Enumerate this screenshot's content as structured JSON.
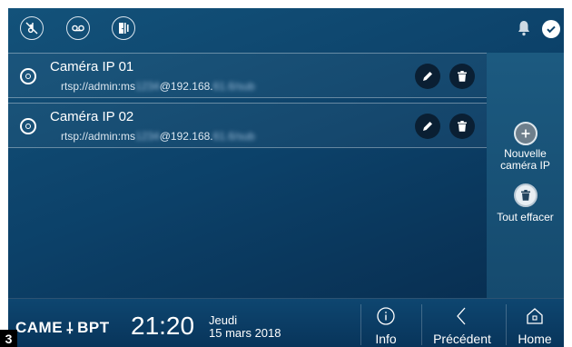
{
  "topbar": {
    "icons": [
      "music-mute-icon",
      "voicemail-icon",
      "door-icon"
    ],
    "right_icons": [
      "bell-icon",
      "check-icon"
    ]
  },
  "cameras": [
    {
      "name": "Caméra IP 01",
      "url_prefix": "rtsp://admin:ms",
      "url_hidden_1": "1234",
      "url_host": "@192.168.",
      "url_hidden_2": "61.6/sub"
    },
    {
      "name": "Caméra IP 02",
      "url_prefix": "rtsp://admin:ms",
      "url_hidden_1": "1234",
      "url_host": "@192.168.",
      "url_hidden_2": "61.6/sub"
    }
  ],
  "sidepanel": {
    "add_label_1": "Nouvelle",
    "add_label_2": "caméra IP",
    "clear_label": "Tout effacer"
  },
  "bottombar": {
    "brand_came": "CAME",
    "brand_bpt": "BPT",
    "time": "21:20",
    "weekday": "Jeudi",
    "date": "15 mars 2018",
    "info_label": "Info",
    "prev_label": "Précédent",
    "home_label": "Home"
  },
  "badge": "3",
  "colors": {
    "background": "#0c4169",
    "panel": "#1c5a80",
    "button_dark": "#0a1f33",
    "text": "#ffffff"
  }
}
